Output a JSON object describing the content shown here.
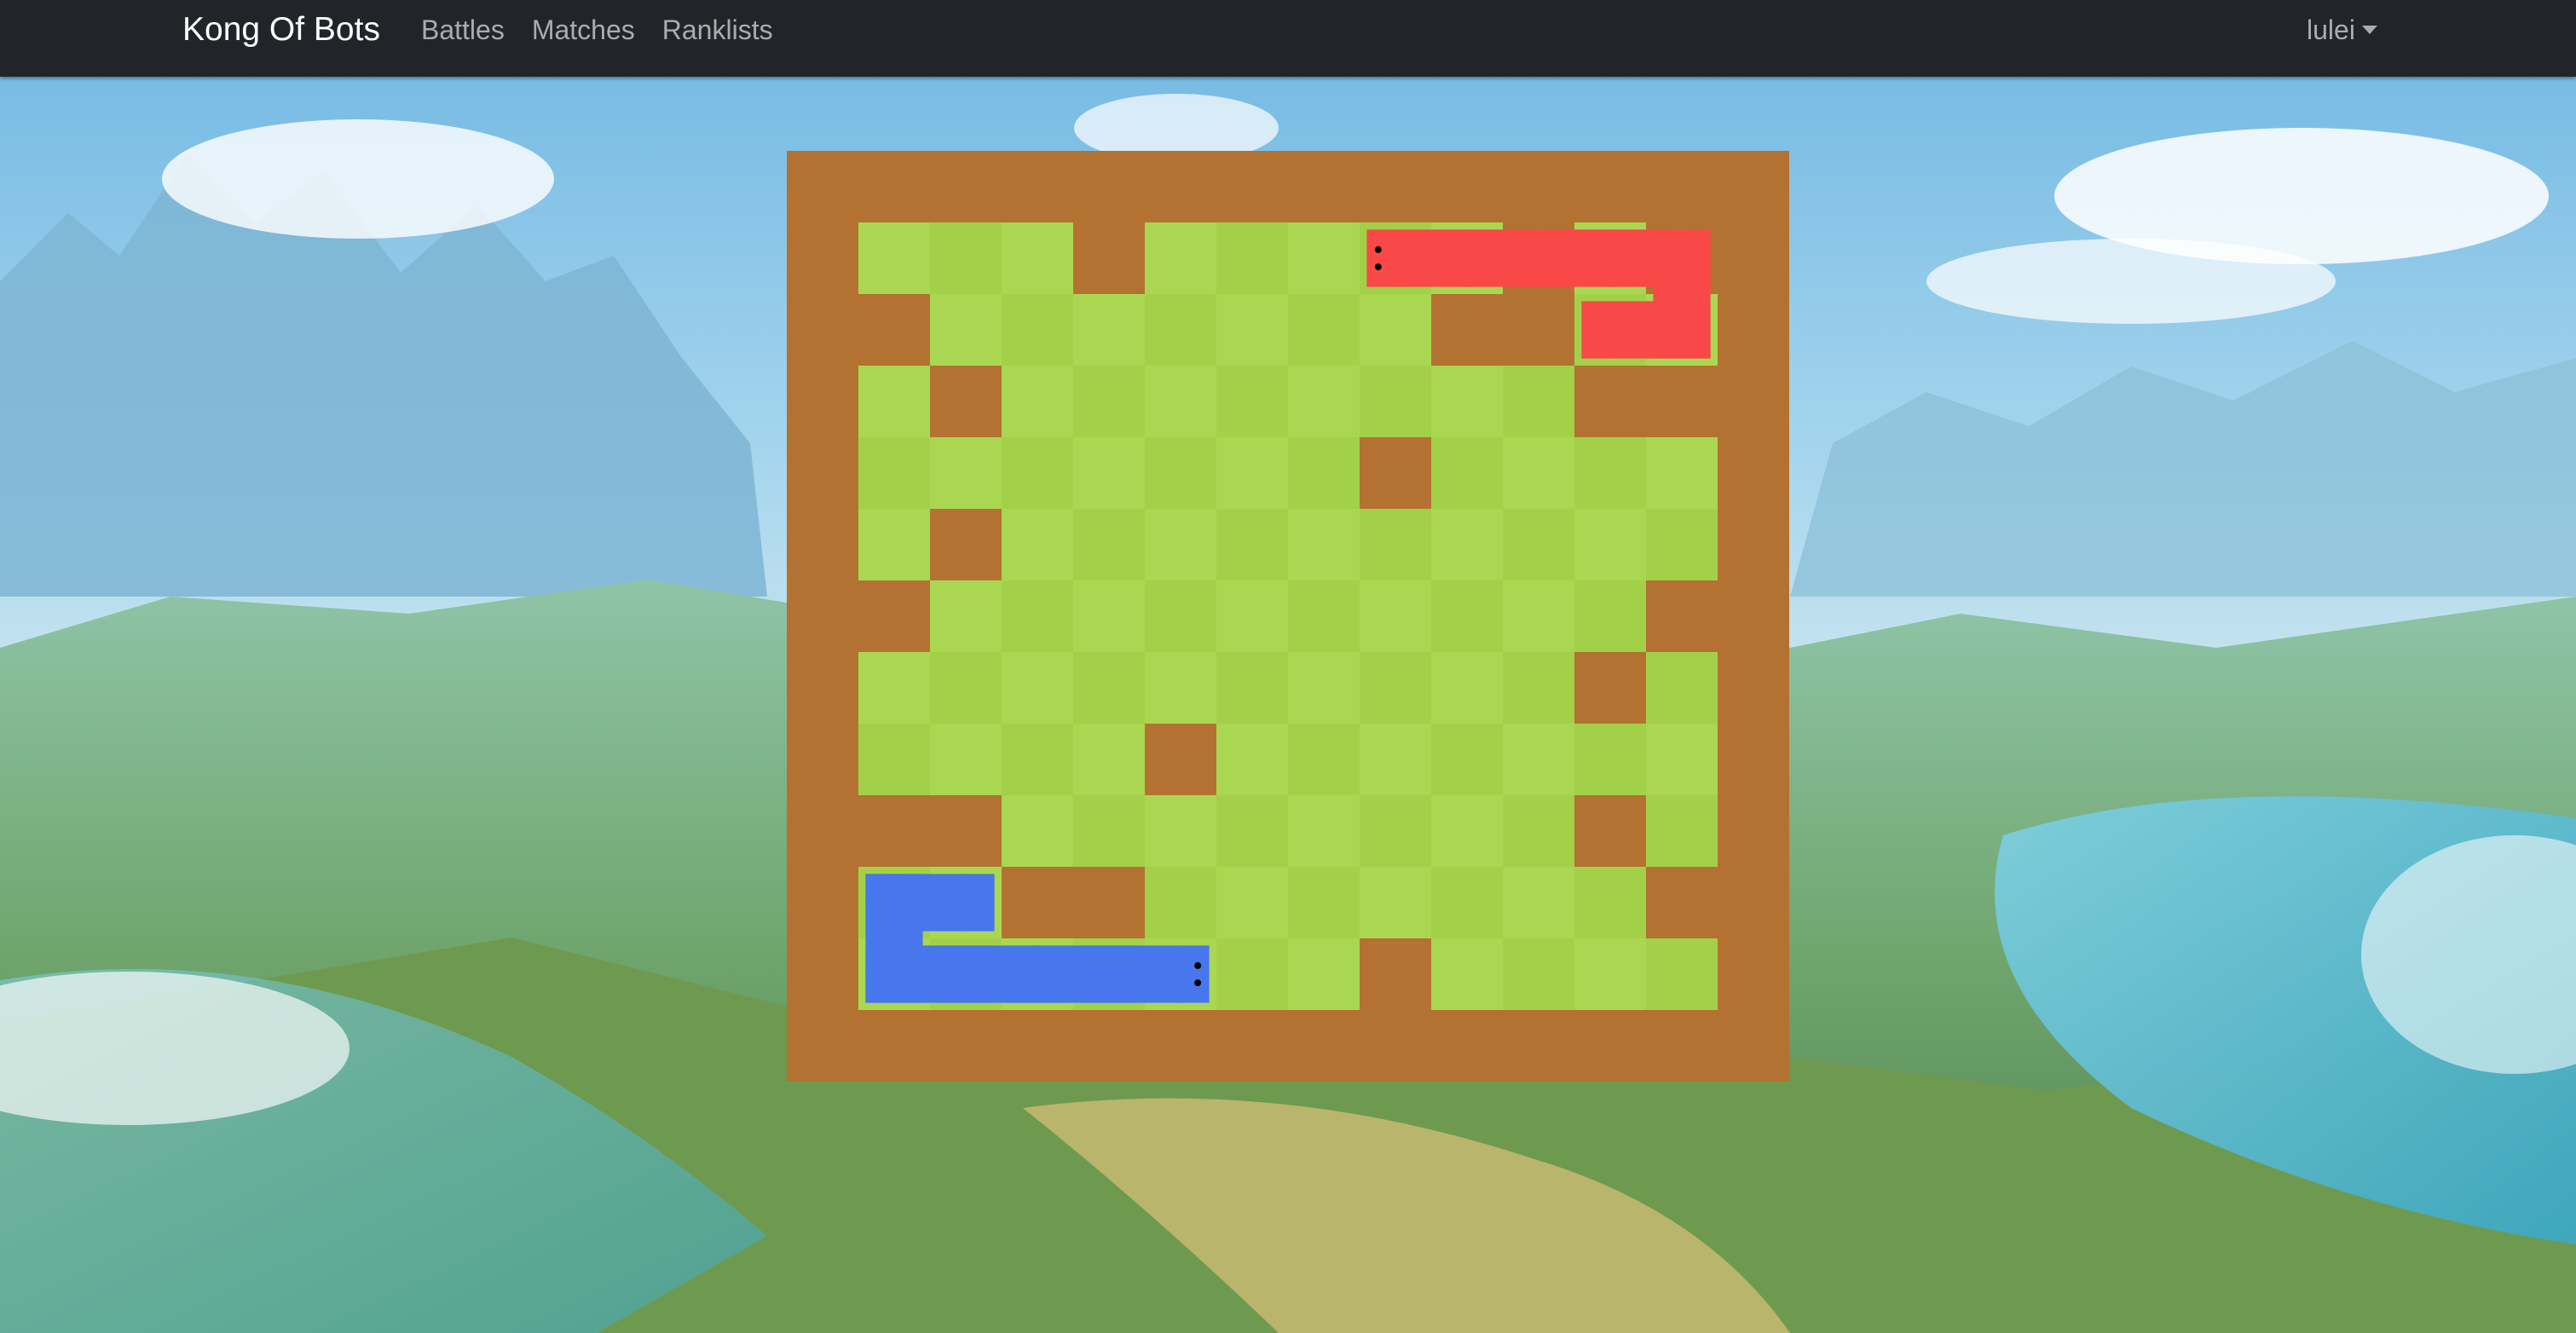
{
  "navbar": {
    "brand": "Kong Of Bots",
    "links": [
      {
        "label": "Battles"
      },
      {
        "label": "Matches"
      },
      {
        "label": "Ranklists"
      }
    ],
    "user": "lulei",
    "background_color": "#212529"
  },
  "game": {
    "rows": 13,
    "cols": 14,
    "colors": {
      "wall": "#B47232",
      "grass_light": "#AAD751",
      "grass_dark": "#A2D149",
      "snake_red": "#F94848",
      "snake_blue": "#4876EC",
      "eye": "#000000"
    },
    "walls": [
      [
        3,
        0
      ],
      [
        9,
        0
      ],
      [
        11,
        0
      ],
      [
        12,
        0
      ],
      [
        0,
        1
      ],
      [
        8,
        1
      ],
      [
        9,
        1
      ],
      [
        1,
        2
      ],
      [
        10,
        2
      ],
      [
        11,
        2
      ],
      [
        7,
        3
      ],
      [
        1,
        4
      ],
      [
        0,
        5
      ],
      [
        11,
        5
      ],
      [
        10,
        6
      ],
      [
        4,
        7
      ],
      [
        0,
        8
      ],
      [
        1,
        8
      ],
      [
        10,
        8
      ],
      [
        2,
        9
      ],
      [
        3,
        9
      ],
      [
        11,
        9
      ],
      [
        7,
        10
      ]
    ],
    "snakes": [
      {
        "name": "red",
        "color_key": "snake_red",
        "cells": [
          [
            7,
            0
          ],
          [
            8,
            0
          ],
          [
            9,
            0
          ],
          [
            10,
            0
          ],
          [
            11,
            0
          ],
          [
            11,
            1
          ],
          [
            10,
            1
          ]
        ],
        "eyes_facing": "left"
      },
      {
        "name": "blue",
        "color_key": "snake_blue",
        "cells": [
          [
            4,
            10
          ],
          [
            3,
            10
          ],
          [
            2,
            10
          ],
          [
            1,
            10
          ],
          [
            0,
            10
          ],
          [
            0,
            9
          ],
          [
            1,
            9
          ]
        ],
        "eyes_facing": "right"
      }
    ]
  }
}
